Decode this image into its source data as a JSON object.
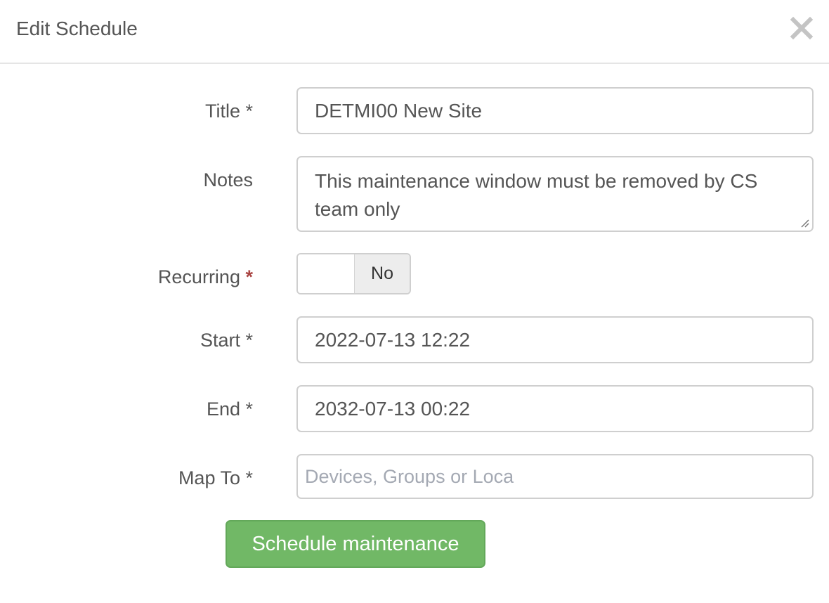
{
  "modal": {
    "title": "Edit Schedule",
    "close_icon": "close-icon"
  },
  "form": {
    "title": {
      "label": "Title *",
      "value": "DETMI00 New Site"
    },
    "notes": {
      "label": "Notes",
      "value": "This maintenance window must be removed by CS team only"
    },
    "recurring": {
      "label": "Recurring",
      "required_mark": "*",
      "value": "No"
    },
    "start": {
      "label": "Start *",
      "value": "2022-07-13 12:22"
    },
    "end": {
      "label": "End *",
      "value": "2032-07-13 00:22"
    },
    "map_to": {
      "label": "Map To *",
      "placeholder": "Devices, Groups or Loca"
    },
    "submit_label": "Schedule maintenance"
  },
  "colors": {
    "submit": "#71b866",
    "required_mark": "#a94442"
  }
}
